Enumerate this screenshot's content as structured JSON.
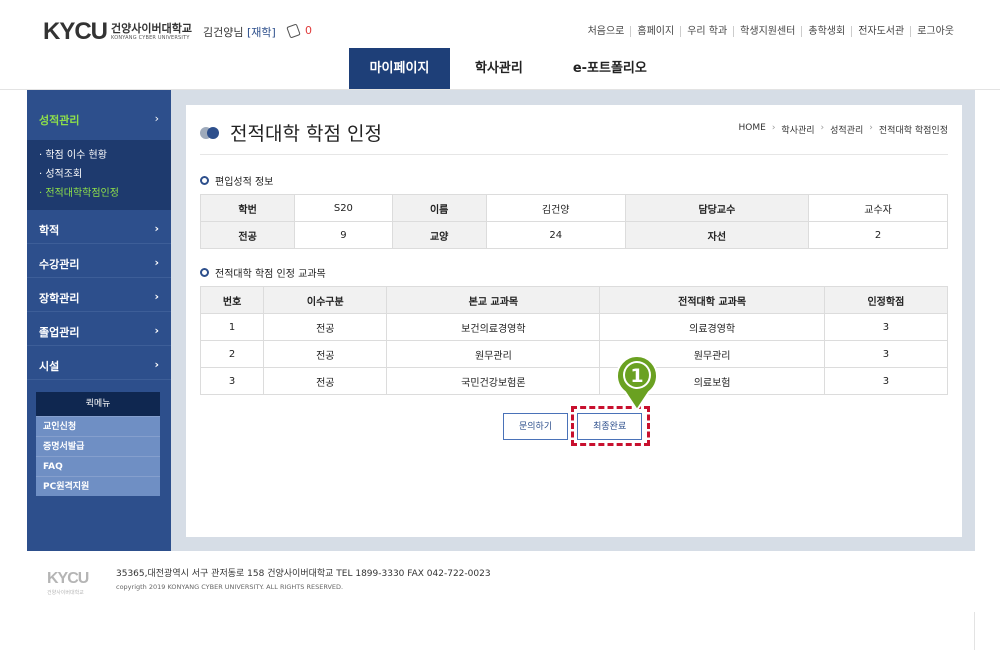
{
  "header": {
    "logo_mark": "KYCU",
    "logo_name_ko": "건양사이버대학교",
    "logo_name_en": "KONYANG CYBER UNIVERSITY",
    "user_name": "김건양님",
    "user_status": "[재학]",
    "message_count": "0",
    "top_links": [
      "처음으로",
      "홈페이지",
      "우리 학과",
      "학생지원센터",
      "총학생회",
      "전자도서관",
      "로그아웃"
    ]
  },
  "main_nav": {
    "tabs": [
      {
        "label": "마이페이지",
        "active": true
      },
      {
        "label": "학사관리",
        "active": false
      },
      {
        "label": "e-포트폴리오",
        "active": false
      }
    ]
  },
  "sidebar": {
    "active_section": "성적관리",
    "sub_items": [
      {
        "label": "· 학점 이수 현황",
        "active": false
      },
      {
        "label": "· 성적조회",
        "active": false
      },
      {
        "label": "· 전적대학학점인정",
        "active": true
      }
    ],
    "sections": [
      "학적",
      "수강관리",
      "장학관리",
      "졸업관리",
      "시설"
    ],
    "chevron": "›",
    "quick_menu": {
      "title": "퀵메뉴",
      "items": [
        "교인신청",
        "증명서발급",
        "FAQ",
        "PC원격지원"
      ]
    }
  },
  "page": {
    "title": "전적대학 학점 인정",
    "breadcrumb": [
      "HOME",
      "학사관리",
      "성적관리",
      "전적대학 학점인정"
    ],
    "breadcrumb_sep": "›"
  },
  "transfer_info": {
    "title": "편입성적 정보",
    "rows": [
      [
        {
          "text": "학번",
          "head": true
        },
        {
          "text": "S20"
        },
        {
          "text": "이름",
          "head": true
        },
        {
          "text": "김건양"
        },
        {
          "text": "담당교수",
          "head": true
        },
        {
          "text": "교수자"
        }
      ],
      [
        {
          "text": "전공",
          "head": true
        },
        {
          "text": "9"
        },
        {
          "text": "교양",
          "head": true
        },
        {
          "text": "24"
        },
        {
          "text": "자선",
          "head": true
        },
        {
          "text": "2"
        }
      ]
    ]
  },
  "credit_courses": {
    "title": "전적대학 학점 인정 교과목",
    "headers": [
      "번호",
      "이수구분",
      "본교 교과목",
      "전적대학 교과목",
      "인정학점"
    ],
    "rows": [
      [
        "1",
        "전공",
        "보건의료경영학",
        "의료경영학",
        "3"
      ],
      [
        "2",
        "전공",
        "원무관리",
        "원무관리",
        "3"
      ],
      [
        "3",
        "전공",
        "국민건강보험론",
        "의료보험",
        "3"
      ]
    ]
  },
  "actions": {
    "inquiry": "문의하기",
    "final_complete": "최종완료"
  },
  "annotation": {
    "step_number": "1",
    "color": "#6aa121"
  },
  "footer": {
    "logo_mark": "KYCU",
    "logo_text": "건양사이버대학교",
    "address": "35365,대전광역시 서구 관저동로 158 건양사이버대학교    TEL 1899-3330    FAX 042-722-0023",
    "copyright": "copyrigth 2019 KONYANG CYBER UNIVERSITY. ALL RIGHTS RESERVED."
  }
}
